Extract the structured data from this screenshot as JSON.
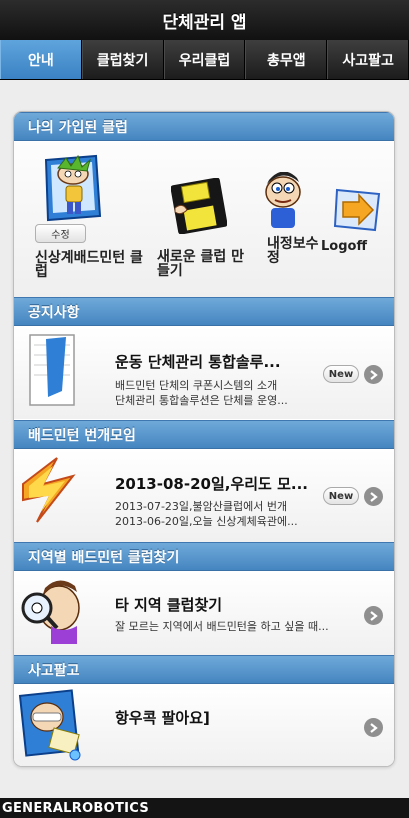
{
  "app": {
    "title": "단체관리 앱"
  },
  "nav": {
    "tabs": [
      {
        "label": "안내"
      },
      {
        "label": "클럽찾기"
      },
      {
        "label": "우리클럽"
      },
      {
        "label": "총무앱"
      },
      {
        "label": "사고팔고"
      }
    ]
  },
  "my_clubs": {
    "header": "나의 가입된 클럽",
    "edit_label": "수정",
    "clubs": [
      {
        "label": "신상계배드민턴 클럽",
        "icon": "cartoon-boy-icon"
      },
      {
        "label": "새로운 클럽 만들기",
        "icon": "floppy-disk-icon"
      },
      {
        "label": "내정보수정",
        "icon": "cartoon-face-icon"
      },
      {
        "label": "Logoff",
        "icon": "arrow-forward-icon"
      }
    ]
  },
  "notice": {
    "header": "공지사항",
    "title": "운동 단체관리 통합솔루...",
    "lines": [
      "배드민턴 단체의 쿠폰시스템의 소개",
      "단체관리 통합솔루션은 단체를 운영..."
    ],
    "badge": "New"
  },
  "flash": {
    "header": "배드민턴 번개모임",
    "title": "2013-08-20일,우리도 모...",
    "lines": [
      "2013-07-23일,불암산클럽에서 번개",
      "2013-06-20일,오늘 신상계체육관에..."
    ],
    "badge": "New"
  },
  "regional": {
    "header": "지역별 배드민턴 클럽찾기",
    "title": "타 지역 클럽찾기",
    "lines": [
      "잘 모르는 지역에서 배드민턴을 하고 싶을 때..."
    ]
  },
  "market": {
    "header": "사고팔고",
    "title": "항우콕 팔아요]"
  },
  "footer": {
    "text": "GENERALROBOTICS"
  },
  "colors": {
    "accent": "#4585c0",
    "active_tab": "#4a92d0",
    "bar": "#1c1c1c"
  }
}
